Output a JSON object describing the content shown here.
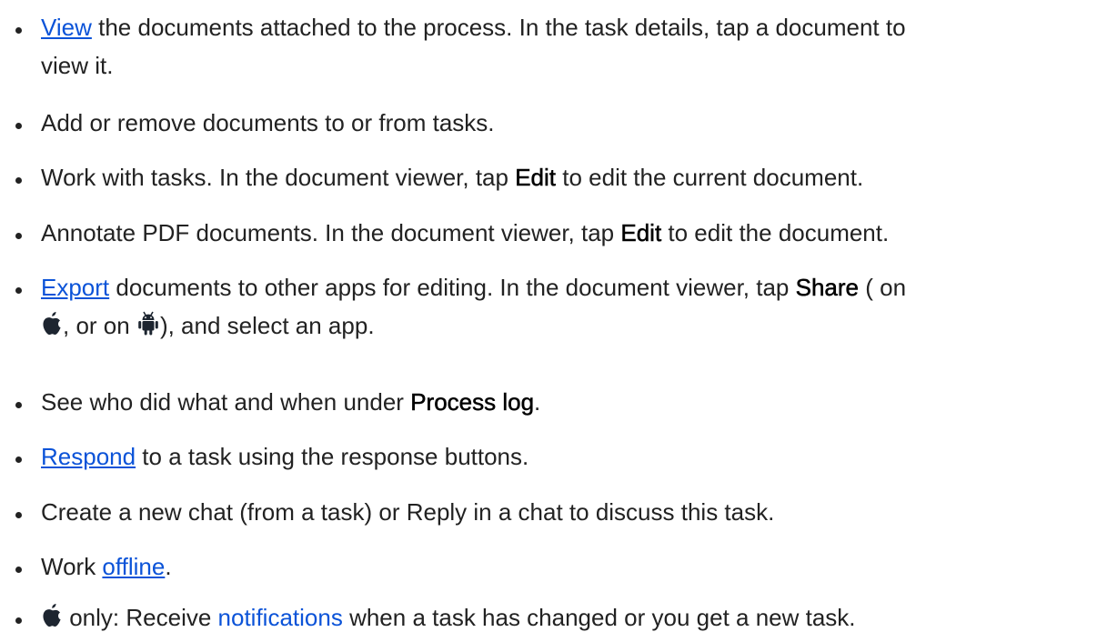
{
  "items": [
    {
      "link": "View",
      "text1": " the documents attached to the process. In the task details, tap a document to",
      "text2": "view it."
    },
    {
      "text": "Add or remove documents to or from tasks."
    },
    {
      "pre": "Work with tasks. In the document viewer, tap ",
      "bold": "Edit",
      "post": " to edit the current document."
    },
    {
      "pre": "Annotate PDF documents. In the document viewer, tap ",
      "bold": "Edit",
      "post": " to edit the document."
    },
    {
      "link": "Export",
      "text1": " documents to other apps for editing. In the document viewer, tap ",
      "bold": "Share",
      "text1b": " ( on",
      "text2a": ", or  on ",
      "text2b": "), and select an app."
    },
    {
      "pre": "See who did what and when under ",
      "bold": "Process log",
      "post": "."
    },
    {
      "link": "Respond",
      "post": " to a task using the response buttons."
    },
    {
      "text": "Create a new chat (from a task) or Reply in a chat to discuss this task."
    },
    {
      "pre": "Work ",
      "link": "offline",
      "post": "."
    },
    {
      "pre": " only: Receive ",
      "link": "notifications",
      "post": " when a task has changed or you get a new task."
    }
  ],
  "icons": {
    "apple": "apple-logo-icon",
    "android": "android-logo-icon"
  },
  "colors": {
    "text": "#222222",
    "link": "#0b53d8"
  }
}
